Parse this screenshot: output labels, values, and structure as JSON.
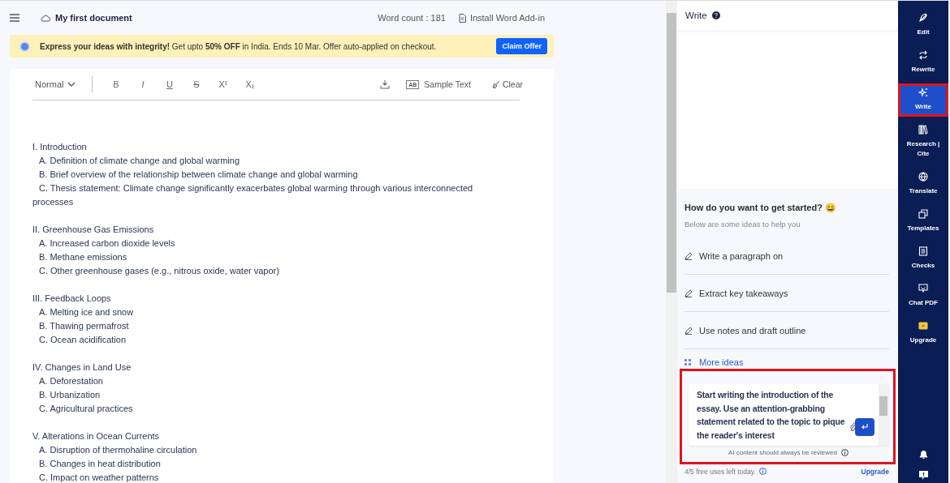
{
  "header": {
    "title": "My first document",
    "word_count": "Word count : 181",
    "addin": "Install Word Add-in"
  },
  "banner": {
    "text": "**Express your ideas with integrity!** Get upto **50% OFF** in India. Ends 10 Mar. Offer auto-applied on checkout.",
    "button": "Claim Offer"
  },
  "toolbar": {
    "style": "Normal",
    "formats": [
      {
        "kind": "bold",
        "label": "B"
      },
      {
        "kind": "italic",
        "label": "I"
      },
      {
        "kind": "underline",
        "label": "U"
      },
      {
        "kind": "strike",
        "label": "S"
      },
      {
        "kind": "sup",
        "label": "X¹"
      },
      {
        "kind": "sub",
        "label": "X₁"
      }
    ],
    "sample": "Sample Text",
    "sample_badge": "AB",
    "clear": "Clear"
  },
  "document": [
    {
      "heading": "I. Introduction",
      "items": [
        "A. Definition of climate change and global warming",
        "B. Brief overview of the relationship between climate change and global warming",
        "C. Thesis statement: Climate change significantly exacerbates global warming through various interconnected processes"
      ]
    },
    {
      "heading": "II. Greenhouse Gas Emissions",
      "items": [
        "A. Increased carbon dioxide levels",
        "B. Methane emissions",
        "C. Other greenhouse gases (e.g., nitrous oxide, water vapor)"
      ]
    },
    {
      "heading": "III. Feedback Loops",
      "items": [
        "A. Melting ice and snow",
        "B. Thawing permafrost",
        "C. Ocean acidification"
      ]
    },
    {
      "heading": "IV. Changes in Land Use",
      "items": [
        "A. Deforestation",
        "B. Urbanization",
        "C. Agricultural practices"
      ]
    },
    {
      "heading": "V. Alterations in Ocean Currents",
      "items": [
        "A. Disruption of thermohaline circulation",
        "B. Changes in heat distribution",
        "C. Impact on weather patterns"
      ]
    }
  ],
  "panel": {
    "title": "Write",
    "intro_title": "How do you want to get started? 😄",
    "intro_subtitle": "Below are some ideas to help you",
    "ideas": [
      "Write a paragraph on",
      "Extract key takeaways",
      "Use notes and draft outline"
    ],
    "more": "More ideas",
    "prompt": {
      "value": "Start writing the introduction of the essay. Use an attention-grabbing statement related to the topic to pique the reader's interest",
      "highlighted": true
    },
    "disclaimer": "AI content should always be reviewed",
    "usage": "4/5 free uses left today.",
    "upgrade": "Upgrade"
  },
  "rail": [
    {
      "kind": "edit",
      "label": "Edit",
      "selected": false,
      "highlighted": false
    },
    {
      "kind": "rewrite",
      "label": "Rewrite",
      "selected": false,
      "highlighted": false
    },
    {
      "kind": "write",
      "label": "Write",
      "selected": true,
      "highlighted": true
    },
    {
      "kind": "research",
      "label": "Research | Cite",
      "selected": false,
      "highlighted": false
    },
    {
      "kind": "translate",
      "label": "Translate",
      "selected": false,
      "highlighted": false
    },
    {
      "kind": "templates",
      "label": "Templates",
      "selected": false,
      "highlighted": false
    },
    {
      "kind": "checks",
      "label": "Checks",
      "selected": false,
      "highlighted": false
    },
    {
      "kind": "chat",
      "label": "Chat PDF",
      "selected": false,
      "highlighted": false
    },
    {
      "kind": "upgrade",
      "label": "Upgrade",
      "selected": false,
      "highlighted": false
    }
  ]
}
